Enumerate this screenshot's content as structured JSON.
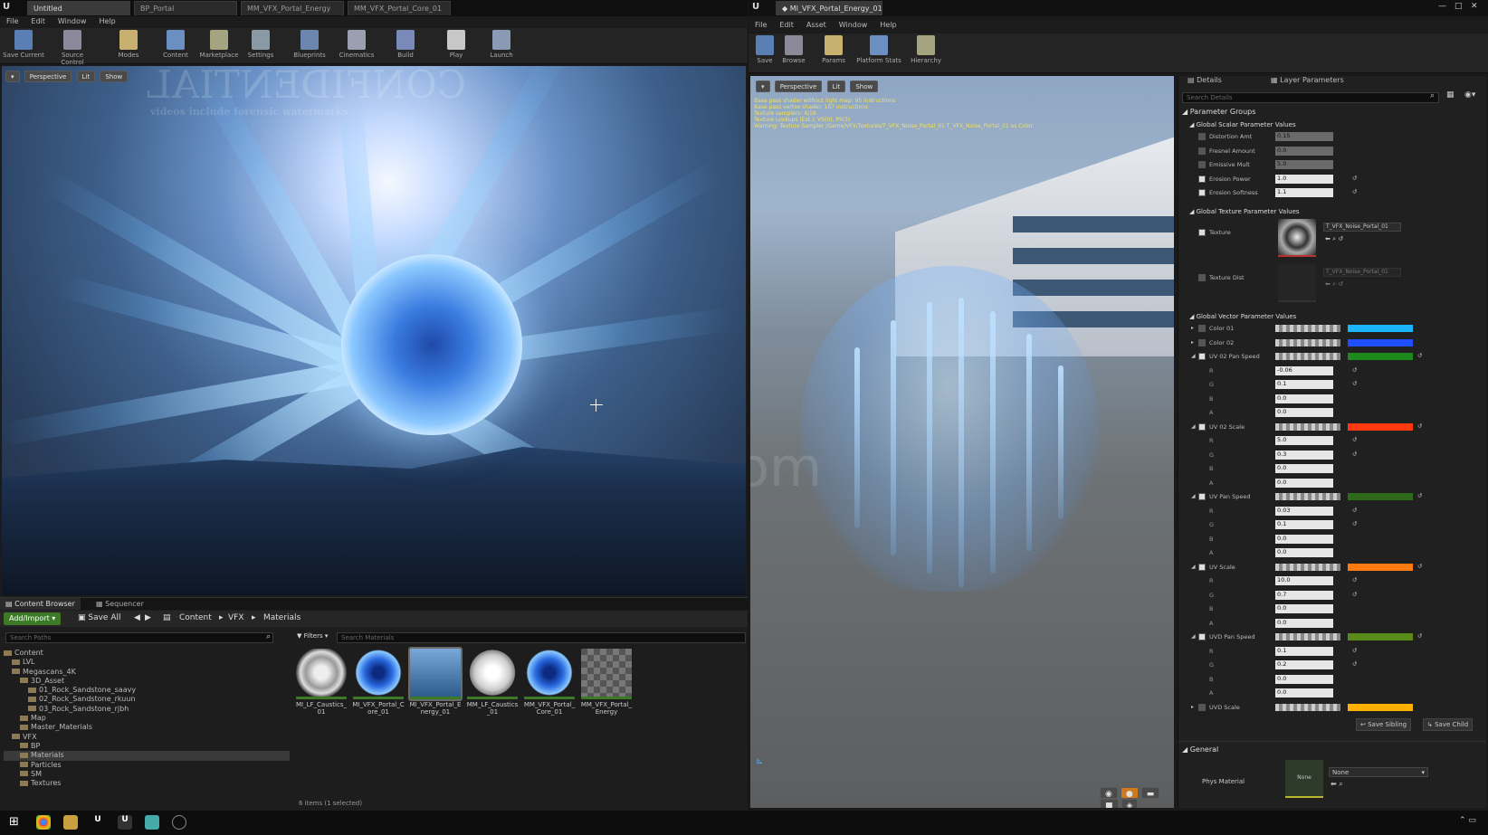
{
  "left": {
    "tabs": [
      "Untitled",
      "BP_Portal",
      "MM_VFX_Portal_Energy",
      "MM_VFX_Portal_Core_01"
    ],
    "menu": [
      "File",
      "Edit",
      "Window",
      "Help"
    ],
    "toolbar": [
      "Save Current",
      "Source Control",
      "Modes",
      "Content",
      "Marketplace",
      "Settings",
      "Blueprints",
      "Cinematics",
      "Build",
      "Play",
      "Launch"
    ],
    "viewport_buttons": [
      "Perspective",
      "Lit",
      "Show"
    ],
    "watermark_top": "CONFIDENTIAL",
    "watermark_sub": "videos include forensic watermarks"
  },
  "content_browser": {
    "tabs": [
      "Content Browser",
      "Sequencer"
    ],
    "add_import": "Add/Import",
    "save_all": "Save All",
    "breadcrumb": [
      "Content",
      "VFX",
      "Materials"
    ],
    "search_paths": "Search Paths",
    "filters": "Filters",
    "search_materials": "Search Materials",
    "tree": [
      {
        "label": "Content",
        "indent": 0
      },
      {
        "label": "LVL",
        "indent": 1
      },
      {
        "label": "Megascans_4K",
        "indent": 1
      },
      {
        "label": "3D_Asset",
        "indent": 2
      },
      {
        "label": "01_Rock_Sandstone_saavy",
        "indent": 3
      },
      {
        "label": "02_Rock_Sandstone_rkuun",
        "indent": 3
      },
      {
        "label": "03_Rock_Sandstone_rjbh",
        "indent": 3
      },
      {
        "label": "Map",
        "indent": 2
      },
      {
        "label": "Master_Materials",
        "indent": 2
      },
      {
        "label": "VFX",
        "indent": 1
      },
      {
        "label": "BP",
        "indent": 2
      },
      {
        "label": "Materials",
        "indent": 2
      },
      {
        "label": "Particles",
        "indent": 2
      },
      {
        "label": "SM",
        "indent": 2
      },
      {
        "label": "Textures",
        "indent": 2
      }
    ],
    "assets": [
      {
        "name": "MI_LF_Caustics_01",
        "style": "caustic"
      },
      {
        "name": "MI_VFX_Portal_Core_01",
        "style": "core"
      },
      {
        "name": "MI_VFX_Portal_Energy_01",
        "style": "energy"
      },
      {
        "name": "MM_LF_Caustics_01",
        "style": "white"
      },
      {
        "name": "MM_VFX_Portal_Core_01",
        "style": "core"
      },
      {
        "name": "MM_VFX_Portal_Energy",
        "style": "checker"
      }
    ],
    "status": "6 items (1 selected)"
  },
  "right": {
    "tab": "MI_VFX_Portal_Energy_01",
    "menu": [
      "File",
      "Edit",
      "Asset",
      "Window",
      "Help"
    ],
    "toolbar": [
      "Save",
      "Browse",
      "Params",
      "Platform Stats",
      "Hierarchy"
    ],
    "viewport_buttons": [
      "Perspective",
      "Lit",
      "Show"
    ],
    "log": [
      "Base pass shader without light map: 95 instructions",
      "Base pass vertex shader: 107 instructions",
      "Texture samplers: 4/16",
      "Texture Lookups (Est.): VS(0), PS(3)",
      "Warning: Texture Sampler /Game/VFX/Textures/T_VFX_Noise_Portal_01 T_VFX_Noise_Portal_01 as Color."
    ],
    "watermark": "iiivfx.com"
  },
  "details": {
    "tabs": [
      "Details",
      "Layer Parameters"
    ],
    "search": "Search Details",
    "parameter_groups": "Parameter Groups",
    "scalar_header": "Global Scalar Parameter Values",
    "scalars": [
      {
        "label": "Distortion Amt",
        "value": "0.15",
        "enabled": false
      },
      {
        "label": "Fresnel Amount",
        "value": "0.0",
        "enabled": false
      },
      {
        "label": "Emissive Mult",
        "value": "5.0",
        "enabled": false
      },
      {
        "label": "Erosion Power",
        "value": "1.0",
        "enabled": true
      },
      {
        "label": "Erosion Softness",
        "value": "1.1",
        "enabled": true
      }
    ],
    "texture_header": "Global Texture Parameter Values",
    "textures": [
      {
        "label": "Texture",
        "value": "T_VFX_Noise_Portal_01",
        "enabled": true
      },
      {
        "label": "Texture Dist",
        "value": "T_VFX_Noise_Portal_01",
        "enabled": false
      }
    ],
    "vector_header": "Global Vector Parameter Values",
    "vectors": [
      {
        "label": "Color 01",
        "enabled": false,
        "color": "#1ab6ff",
        "channels": []
      },
      {
        "label": "Color 02",
        "enabled": false,
        "color": "#1f4fff",
        "channels": []
      },
      {
        "label": "UV 02 Pan Speed",
        "enabled": true,
        "color": "#1e8a1e",
        "channels": [
          {
            "c": "R",
            "v": "-0.06"
          },
          {
            "c": "G",
            "v": "0.1"
          },
          {
            "c": "B",
            "v": "0.0"
          },
          {
            "c": "A",
            "v": "0.0"
          }
        ]
      },
      {
        "label": "UV 02 Scale",
        "enabled": true,
        "color": "#ff3a10",
        "channels": [
          {
            "c": "R",
            "v": "5.0"
          },
          {
            "c": "G",
            "v": "0.3"
          },
          {
            "c": "B",
            "v": "0.0"
          },
          {
            "c": "A",
            "v": "0.0"
          }
        ]
      },
      {
        "label": "UV Pan Speed",
        "enabled": true,
        "color": "#2e6a1a",
        "channels": [
          {
            "c": "R",
            "v": "0.03"
          },
          {
            "c": "G",
            "v": "0.1"
          },
          {
            "c": "B",
            "v": "0.0"
          },
          {
            "c": "A",
            "v": "0.0"
          }
        ]
      },
      {
        "label": "UV Scale",
        "enabled": true,
        "color": "#ff7a10",
        "channels": [
          {
            "c": "R",
            "v": "10.0"
          },
          {
            "c": "G",
            "v": "0.7"
          },
          {
            "c": "B",
            "v": "0.0"
          },
          {
            "c": "A",
            "v": "0.0"
          }
        ]
      },
      {
        "label": "UVD Pan Speed",
        "enabled": true,
        "color": "#5a8a1a",
        "channels": [
          {
            "c": "R",
            "v": "0.1"
          },
          {
            "c": "G",
            "v": "0.2"
          },
          {
            "c": "B",
            "v": "0.0"
          },
          {
            "c": "A",
            "v": "0.0"
          }
        ]
      },
      {
        "label": "UVD Scale",
        "enabled": false,
        "color": "#ffb000",
        "channels": []
      }
    ],
    "save_sibling": "Save Sibling",
    "save_child": "Save Child",
    "general_header": "General",
    "phys_material_label": "Phys Material",
    "phys_thumb": "None",
    "phys_value": "None"
  },
  "colors": {
    "accent_green": "#3d7a28",
    "log_yellow": "#f0e060"
  }
}
